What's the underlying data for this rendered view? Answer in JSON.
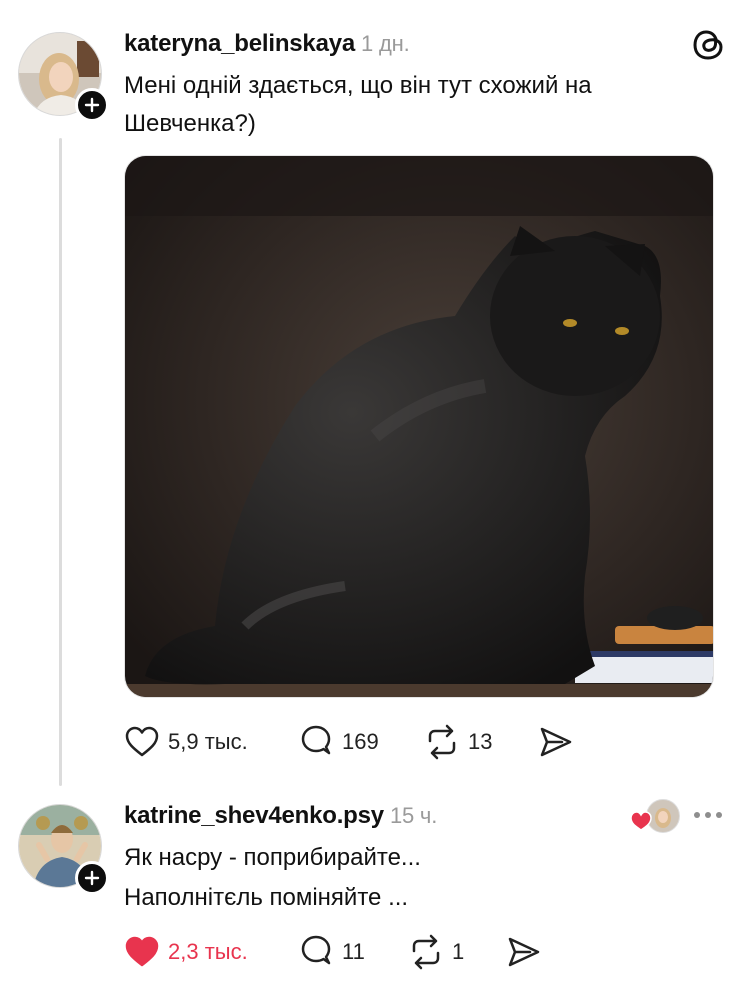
{
  "post": {
    "username": "kateryna_belinskaya",
    "time": "1 дн.",
    "text": "Мені одній здається, що він тут схожий на Шевченка?)",
    "image_description": "black cat sitting",
    "actions": {
      "likes": "5,9 тыс.",
      "replies": "169",
      "reposts": "13"
    }
  },
  "reply": {
    "username": "katrine_shev4enko.psy",
    "time": "15 ч.",
    "lines": [
      "Як насру - поприбирайте...",
      "Наполнітєль поміняйте ..."
    ],
    "actions": {
      "likes": "2,3 тыс.",
      "replies": "11",
      "reposts": "1"
    }
  },
  "colors": {
    "like_active": "#e8344e",
    "time_gray": "#9a9a9a",
    "thread_line": "#dcdcdc"
  },
  "icons": [
    "threads-logo-icon",
    "heart-icon",
    "comment-icon",
    "repost-icon",
    "share-icon",
    "more-icon",
    "plus-icon"
  ]
}
